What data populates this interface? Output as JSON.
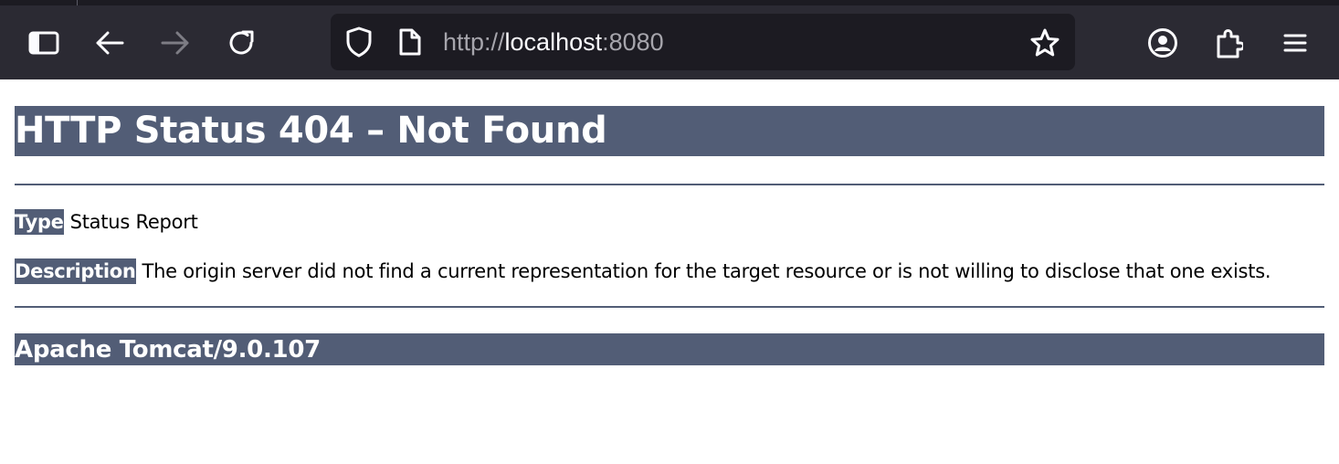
{
  "browser": {
    "url_scheme": "http://",
    "url_host": "localhost",
    "url_port": ":8080",
    "icons": {
      "sidebar": "sidebar-icon",
      "back": "back-arrow-icon",
      "forward": "forward-arrow-icon",
      "reload": "reload-icon",
      "tracking": "shield-icon",
      "page": "page-icon",
      "bookmark": "star-icon",
      "account": "account-icon",
      "extensions": "extensions-icon",
      "menu": "hamburger-menu-icon"
    }
  },
  "page": {
    "title": "HTTP Status 404 – Not Found",
    "type_label": "Type",
    "type_value": "Status Report",
    "description_label": "Description",
    "description_value": "The origin server did not find a current representation for the target resource or is not willing to disclose that one exists.",
    "server": "Apache Tomcat/9.0.107"
  },
  "colors": {
    "accent": "#525d76",
    "toolbar": "#2b2a33",
    "urlbar": "#1c1b22"
  }
}
